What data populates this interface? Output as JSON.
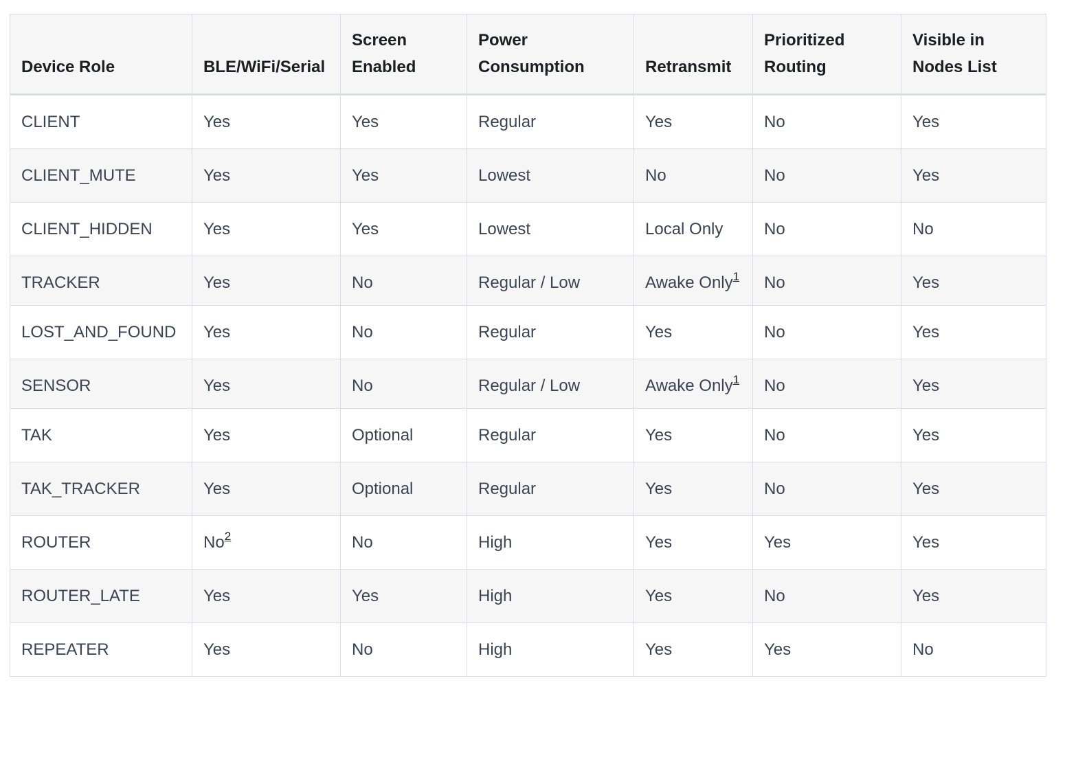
{
  "table": {
    "headers": [
      "Device Role",
      "BLE/WiFi/Serial",
      "Screen Enabled",
      "Power Consumption",
      "Retransmit",
      "Prioritized Routing",
      "Visible in Nodes List"
    ],
    "rows": [
      {
        "role": "CLIENT",
        "ble": "Yes",
        "screen": "Yes",
        "power": "Regular",
        "retransmit": "Yes",
        "routing": "No",
        "visible": "Yes"
      },
      {
        "role": "CLIENT_MUTE",
        "ble": "Yes",
        "screen": "Yes",
        "power": "Lowest",
        "retransmit": "No",
        "routing": "No",
        "visible": "Yes"
      },
      {
        "role": "CLIENT_HIDDEN",
        "ble": "Yes",
        "screen": "Yes",
        "power": "Lowest",
        "retransmit": "Local Only",
        "routing": "No",
        "visible": "No"
      },
      {
        "role": "TRACKER",
        "ble": "Yes",
        "screen": "No",
        "power": "Regular / Low",
        "retransmit": "Awake Only",
        "retransmit_footnote": "1",
        "routing": "No",
        "visible": "Yes"
      },
      {
        "role": "LOST_AND_FOUND",
        "ble": "Yes",
        "screen": "No",
        "power": "Regular",
        "retransmit": "Yes",
        "routing": "No",
        "visible": "Yes"
      },
      {
        "role": "SENSOR",
        "ble": "Yes",
        "screen": "No",
        "power": "Regular / Low",
        "retransmit": "Awake Only",
        "retransmit_footnote": "1",
        "routing": "No",
        "visible": "Yes"
      },
      {
        "role": "TAK",
        "ble": "Yes",
        "screen": "Optional",
        "power": "Regular",
        "retransmit": "Yes",
        "routing": "No",
        "visible": "Yes"
      },
      {
        "role": "TAK_TRACKER",
        "ble": "Yes",
        "screen": "Optional",
        "power": "Regular",
        "retransmit": "Yes",
        "routing": "No",
        "visible": "Yes"
      },
      {
        "role": "ROUTER",
        "ble": "No",
        "ble_footnote": "2",
        "screen": "No",
        "power": "High",
        "retransmit": "Yes",
        "routing": "Yes",
        "visible": "Yes"
      },
      {
        "role": "ROUTER_LATE",
        "ble": "Yes",
        "screen": "Yes",
        "power": "High",
        "retransmit": "Yes",
        "routing": "No",
        "visible": "Yes"
      },
      {
        "role": "REPEATER",
        "ble": "Yes",
        "screen": "No",
        "power": "High",
        "retransmit": "Yes",
        "routing": "Yes",
        "visible": "No"
      }
    ]
  }
}
